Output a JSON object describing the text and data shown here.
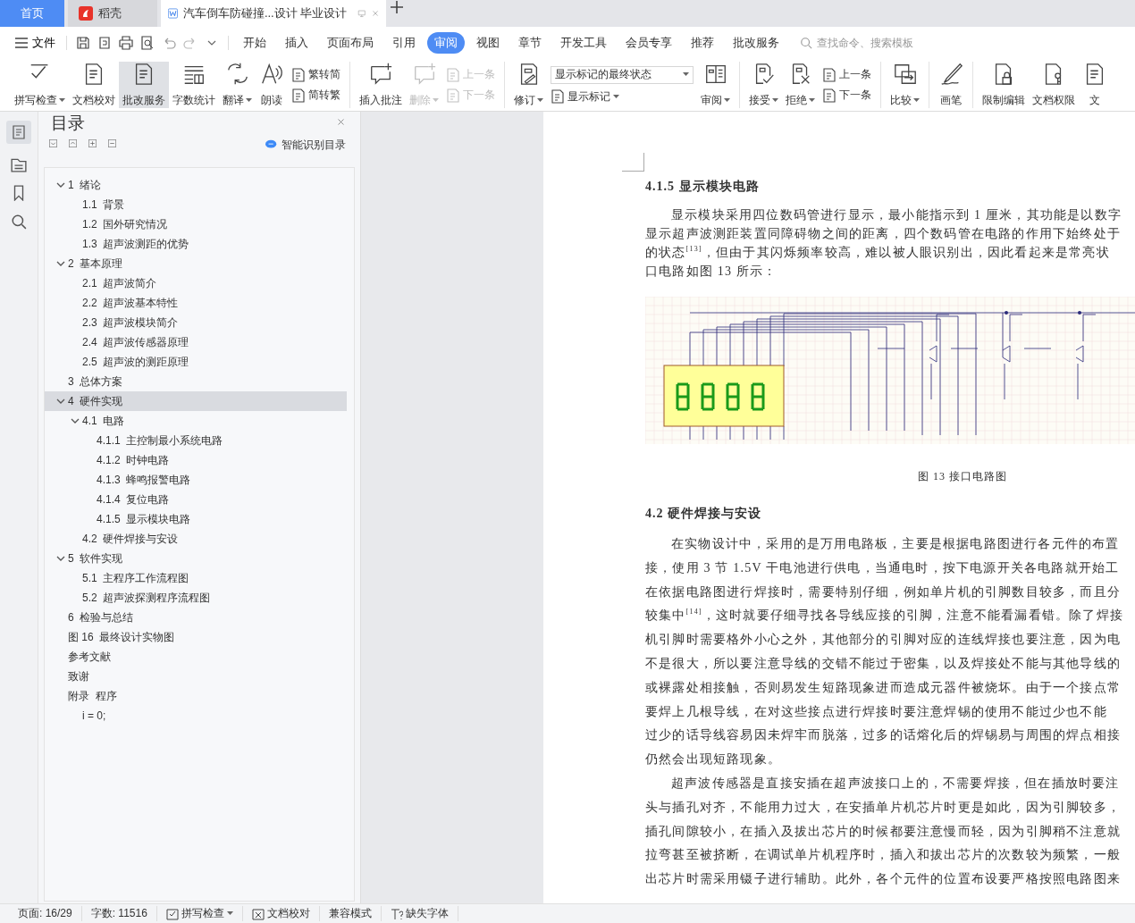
{
  "title_tabs": [
    {
      "kind": "home",
      "label": "首页",
      "selected": false
    },
    {
      "kind": "app",
      "label": "稻壳",
      "selected": false
    },
    {
      "kind": "document",
      "label": "汽车倒车防碰撞...设计 毕业设计",
      "selected": true
    }
  ],
  "menu": {
    "file": "文件",
    "tabs": [
      {
        "label": "开始",
        "selected": false
      },
      {
        "label": "插入",
        "selected": false
      },
      {
        "label": "页面布局",
        "selected": false
      },
      {
        "label": "引用",
        "selected": false
      },
      {
        "label": "审阅",
        "selected": true
      },
      {
        "label": "视图",
        "selected": false
      },
      {
        "label": "章节",
        "selected": false
      },
      {
        "label": "开发工具",
        "selected": false
      },
      {
        "label": "会员专享",
        "selected": false
      },
      {
        "label": "推荐",
        "selected": false
      },
      {
        "label": "批改服务",
        "selected": false
      }
    ],
    "search": {
      "placeholder": "查找命令、搜索模板"
    }
  },
  "ribbon": {
    "groups": [
      [
        {
          "kind": "large",
          "label": "拼写检查",
          "menu": true,
          "pressed": false,
          "disabled": false
        },
        {
          "kind": "large",
          "label": "文档校对",
          "menu": false,
          "pressed": false,
          "disabled": false
        },
        {
          "kind": "large",
          "label": "批改服务",
          "menu": false,
          "pressed": true,
          "disabled": false
        },
        {
          "kind": "large",
          "label": "字数统计",
          "menu": false,
          "pressed": false,
          "disabled": false
        },
        {
          "kind": "large",
          "label": "翻译",
          "menu": true,
          "pressed": false,
          "disabled": false
        },
        {
          "kind": "large",
          "label": "朗读",
          "menu": false,
          "pressed": false,
          "disabled": false
        },
        {
          "kind": "stack",
          "items": [
            {
              "kind": "small",
              "label": "繁转简",
              "menu": false,
              "disabled": false
            },
            {
              "kind": "small",
              "label": "简转繁",
              "menu": false,
              "disabled": false
            }
          ]
        }
      ],
      [
        {
          "kind": "large",
          "label": "插入批注",
          "menu": false,
          "pressed": false,
          "disabled": false
        },
        {
          "kind": "large",
          "label": "删除",
          "menu": true,
          "pressed": false,
          "disabled": true
        },
        {
          "kind": "stack",
          "items": [
            {
              "kind": "small",
              "label": "上一条",
              "menu": false,
              "disabled": true
            },
            {
              "kind": "small",
              "label": "下一条",
              "menu": false,
              "disabled": true
            }
          ]
        }
      ],
      [
        {
          "kind": "large",
          "label": "修订",
          "menu": true,
          "pressed": false,
          "disabled": false
        },
        {
          "kind": "stack",
          "items": [
            {
              "kind": "select",
              "value": "显示标记的最终状态"
            },
            {
              "kind": "small",
              "label": "显示标记",
              "menu": true,
              "disabled": false
            }
          ]
        },
        {
          "kind": "large",
          "label": "审阅",
          "menu": true,
          "pressed": false,
          "disabled": false
        }
      ],
      [
        {
          "kind": "large",
          "label": "接受",
          "menu": true,
          "pressed": false,
          "disabled": false
        },
        {
          "kind": "large",
          "label": "拒绝",
          "menu": true,
          "pressed": false,
          "disabled": false
        },
        {
          "kind": "stack",
          "items": [
            {
              "kind": "small",
              "label": "上一条",
              "menu": false,
              "disabled": false
            },
            {
              "kind": "small",
              "label": "下一条",
              "menu": false,
              "disabled": false
            }
          ]
        }
      ],
      [
        {
          "kind": "large",
          "label": "比较",
          "menu": true,
          "pressed": false,
          "disabled": false
        }
      ],
      [
        {
          "kind": "large",
          "label": "画笔",
          "menu": false,
          "pressed": false,
          "disabled": false
        }
      ],
      [
        {
          "kind": "large",
          "label": "限制编辑",
          "menu": false,
          "pressed": false,
          "disabled": false
        },
        {
          "kind": "large",
          "label": "文档权限",
          "menu": false,
          "pressed": false,
          "disabled": false
        },
        {
          "kind": "large",
          "label": "文",
          "menu": false,
          "pressed": false,
          "disabled": false
        }
      ]
    ]
  },
  "toc_panel": {
    "title": "目录",
    "smart_button": "智能识别目录",
    "items": [
      {
        "num": "1",
        "title": "绪论",
        "expanded": true,
        "selected": false,
        "children": [
          {
            "num": "1.1",
            "title": "背景",
            "selected": false
          },
          {
            "num": "1.2",
            "title": "国外研究情况",
            "selected": false
          },
          {
            "num": "1.3",
            "title": "超声波测距的优势",
            "selected": false
          }
        ]
      },
      {
        "num": "2",
        "title": "基本原理",
        "expanded": true,
        "selected": false,
        "children": [
          {
            "num": "2.1",
            "title": "超声波简介",
            "selected": false
          },
          {
            "num": "2.2",
            "title": "超声波基本特性",
            "selected": false
          },
          {
            "num": "2.3",
            "title": "超声波模块简介",
            "selected": false
          },
          {
            "num": "2.4",
            "title": "超声波传感器原理",
            "selected": false
          },
          {
            "num": "2.5",
            "title": "超声波的测距原理",
            "selected": false
          }
        ]
      },
      {
        "num": "3",
        "title": "总体方案",
        "selected": false
      },
      {
        "num": "4",
        "title": "硬件实现",
        "expanded": true,
        "selected": true,
        "children": [
          {
            "num": "4.1",
            "title": "电路",
            "expanded": true,
            "selected": false,
            "children": [
              {
                "num": "4.1.1",
                "title": "主控制最小系统电路",
                "selected": false
              },
              {
                "num": "4.1.2",
                "title": "时钟电路",
                "selected": false
              },
              {
                "num": "4.1.3",
                "title": "蜂鸣报警电路",
                "selected": false
              },
              {
                "num": "4.1.4",
                "title": "复位电路",
                "selected": false
              },
              {
                "num": "4.1.5",
                "title": "显示模块电路",
                "selected": false
              }
            ]
          },
          {
            "num": "4.2",
            "title": "硬件焊接与安设",
            "selected": false
          }
        ]
      },
      {
        "num": "5",
        "title": "软件实现",
        "expanded": true,
        "selected": false,
        "children": [
          {
            "num": "5.1",
            "title": "主程序工作流程图",
            "selected": false
          },
          {
            "num": "5.2",
            "title": "超声波探测程序流程图",
            "selected": false
          }
        ]
      },
      {
        "num": "6",
        "title": "检验与总结",
        "selected": false
      },
      {
        "num": "图 16",
        "title": "最终设计实物图",
        "selected": false
      },
      {
        "title": "参考文献",
        "selected": false
      },
      {
        "title": "致谢",
        "selected": false
      },
      {
        "num": "附录",
        "title": "程序",
        "selected": false,
        "children": [
          {
            "title": "i = 0;",
            "selected": false
          }
        ]
      }
    ]
  },
  "document": {
    "blocks": [
      {
        "kind": "heading",
        "text": "4.1.5  显示模块电路"
      },
      {
        "kind": "paragraph",
        "lines": [
          "显示模块采用四位数码管进行显示，最小能指示到 1 厘米，其功能是以数字",
          "显示超声波测距装置同障碍物之间的距离，四个数码管在电路的作用下始终处于",
          "的状态$^{[13]}$，但由于其闪烁频率较高，难以被人眼识别出，因此看起来是常亮状",
          "口电路如图 13 所示："
        ]
      },
      {
        "kind": "figure",
        "caption": "图 13  接口电路图"
      },
      {
        "kind": "heading",
        "text": "4.2  硬件焊接与安设"
      },
      {
        "kind": "paragraph",
        "lines": [
          "在实物设计中，采用的是万用电路板，主要是根据电路图进行各元件的布置",
          "接，使用 3 节 1.5V 干电池进行供电，当通电时，按下电源开关各电路就开始工",
          "在依据电路图进行焊接时，需要特别仔细，例如单片机的引脚数目较多，而且分",
          "较集中$^{[14]}$，这时就要仔细寻找各导线应接的引脚，注意不能看漏看错。除了焊接",
          "机引脚时需要格外小心之外，其他部分的引脚对应的连线焊接也要注意，因为电",
          "不是很大，所以要注意导线的交错不能过于密集，以及焊接处不能与其他导线的",
          "或裸露处相接触，否则易发生短路现象进而造成元器件被烧坏。由于一个接点常",
          "要焊上几根导线，在对这些接点进行焊接时要注意焊锡的使用不能过少也不能",
          "过少的话导线容易因未焊牢而脱落，过多的话熔化后的焊锡易与周围的焊点相接",
          "仍然会出现短路现象。"
        ]
      },
      {
        "kind": "paragraph",
        "lines": [
          "超声波传感器是直接安插在超声波接口上的，不需要焊接，但在插放时要注",
          "头与插孔对齐，不能用力过大，在安插单片机芯片时更是如此，因为引脚较多，",
          "插孔间隙较小，在插入及拔出芯片的时候都要注意慢而轻，因为引脚稍不注意就",
          "拉弯甚至被挤断，在调试单片机程序时，插入和拔出芯片的次数较为频繁，一般",
          "出芯片时需采用镊子进行辅助。此外，各个元件的位置布设要严格按照电路图来"
        ]
      }
    ]
  },
  "status_bar": [
    {
      "kind": "text",
      "label": "页面: 16/29"
    },
    {
      "kind": "text",
      "label": "字数: 11516"
    },
    {
      "kind": "button",
      "label": "拼写检查",
      "menu": true
    },
    {
      "kind": "button",
      "label": "文档校对",
      "menu": false
    },
    {
      "kind": "text",
      "label": "兼容模式"
    },
    {
      "kind": "button",
      "label": "缺失字体",
      "menu": false
    }
  ]
}
